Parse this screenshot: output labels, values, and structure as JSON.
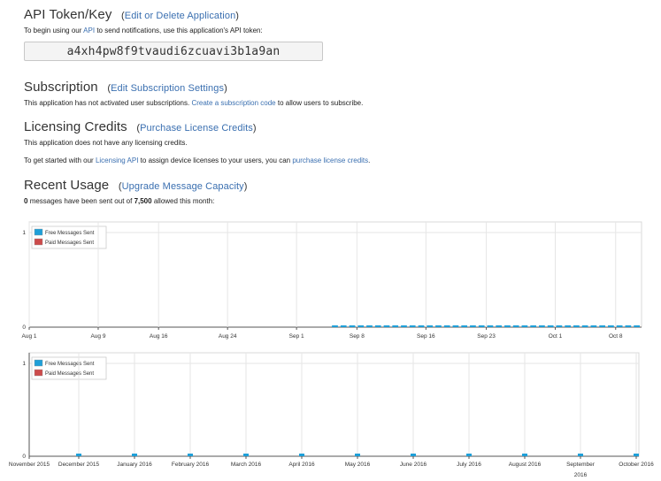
{
  "api_token": {
    "title": "API Token/Key",
    "edit_link": "Edit or Delete Application",
    "desc_prefix": "To begin using our",
    "desc_link": "API",
    "desc_suffix": "to send notifications, use this application's API token:",
    "token": "a4xh4pw8f9tvaudi6zcuavi3b1a9an"
  },
  "subscription": {
    "title": "Subscription",
    "edit_link": "Edit Subscription Settings",
    "desc_prefix": "This application has not activated user subscriptions.",
    "desc_link": "Create a subscription code",
    "desc_suffix": "to allow users to subscribe."
  },
  "licensing": {
    "title": "Licensing Credits",
    "purchase_link": "Purchase License Credits",
    "desc1": "This application does not have any licensing credits.",
    "desc2_prefix": "To get started with our",
    "desc2_link1": "Licensing API",
    "desc2_middle": "to assign device licenses to your users, you can",
    "desc2_link2": "purchase license credits",
    "desc2_suffix": "."
  },
  "usage": {
    "title": "Recent Usage",
    "upgrade_link": "Upgrade Message Capacity",
    "sent_count": "0",
    "sent_middle": "messages have been sent out of",
    "capacity": "7,500",
    "sent_suffix": "allowed this month:"
  },
  "colors": {
    "free": "#1e9fd8",
    "paid": "#cc4b4b",
    "grid": "#e6e6e6",
    "axis": "#555555"
  },
  "chart_data": [
    {
      "type": "bar",
      "legend": [
        "Free Messages Sent",
        "Paid Messages Sent"
      ],
      "legend_position": "top-left",
      "ylim": [
        0,
        1
      ],
      "yticks": [
        "0",
        "1"
      ],
      "xticks": [
        "Aug 1",
        "Aug 9",
        "Aug 16",
        "Aug 24",
        "Sep 1",
        "Sep 8",
        "Sep 16",
        "Sep 23",
        "Oct 1",
        "Oct 8"
      ],
      "days": 71,
      "data_start_day": 35,
      "series": [
        {
          "name": "Free Messages Sent",
          "values_note": "all zero",
          "value": 0
        },
        {
          "name": "Paid Messages Sent",
          "value": 0
        }
      ]
    },
    {
      "type": "bar",
      "legend": [
        "Free Messages Sent",
        "Paid Messages Sent"
      ],
      "legend_position": "top-left",
      "ylim": [
        0,
        1
      ],
      "yticks": [
        "0",
        "1"
      ],
      "xticks": [
        "November 2015",
        "December 2015",
        "January 2016",
        "February 2016",
        "March 2016",
        "April 2016",
        "May 2016",
        "June 2016",
        "July 2016",
        "August 2016",
        "September 2016",
        "October 2016"
      ],
      "series": [
        {
          "name": "Free Messages Sent",
          "values": [
            0,
            0,
            0,
            0,
            0,
            0,
            0,
            0,
            0,
            0,
            0,
            0
          ]
        },
        {
          "name": "Paid Messages Sent",
          "values": [
            0,
            0,
            0,
            0,
            0,
            0,
            0,
            0,
            0,
            0,
            0,
            0
          ]
        }
      ]
    }
  ]
}
